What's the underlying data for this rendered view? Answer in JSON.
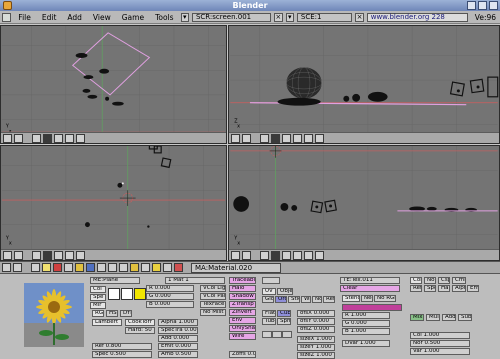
{
  "window": {
    "title": "Blender"
  },
  "menubar": {
    "items": [
      "File",
      "Edit",
      "Add",
      "View",
      "Game",
      "Tools"
    ],
    "screen_field": "SCR:screen.001",
    "scene_field": "SCE:1",
    "url": "www.blender.org 228",
    "ve_label": "Ve:96"
  },
  "viewports": [
    {
      "axis_label": "Y",
      "axis_sub": "Z"
    },
    {
      "axis_label": "Y",
      "axis_sub": "X"
    },
    {
      "axis_label": "Y",
      "axis_sub": "X"
    },
    {
      "axis_label": "Y",
      "axis_sub": "X"
    }
  ],
  "buttonbar": {
    "material_field": "MA:Material.020"
  },
  "material": {
    "me_field": "ME:Plane",
    "mat_count": "1 Mat 1",
    "rgb": [
      "R 0.000",
      "G 0.000",
      "B 0.000"
    ],
    "color_labels": [
      "RGB",
      "HSV",
      "DYN",
      "Col",
      "Spe",
      "Mir"
    ],
    "buttons": {
      "halo": "Halo",
      "traceable": "Traceable",
      "shadow": "Shadow",
      "ztransp": "ZTransp",
      "zinvert": "Zinvert",
      "env": "Env",
      "onlyshadow": "OnlyShadow",
      "wire": "Wire"
    },
    "sliders": {
      "alpha": "Alpha 1.000",
      "spec_tra": "SpecTra 0.00",
      "add": "Add 0.000",
      "emit": "Emit 0.000",
      "amb": "Amb 0.500",
      "ref": "Ref 0.800",
      "spec": "Spec 0.500",
      "hard": "Hard: 50",
      "zoffs": "Zoffs 0.000"
    },
    "shader": {
      "lambert": "Lambert",
      "cooktorr": "CookTorr",
      "vcol_light": "VCol Light",
      "vcol_paint": "VCol Paint",
      "texface": "TexFace",
      "nomist": "No Mist"
    }
  },
  "texture": {
    "tex_field": "TE:Tex.011",
    "clear_label": "Clear",
    "map_buttons": [
      "UV",
      "Object",
      "Glob",
      "Orco",
      "Stick",
      "Win",
      "Nor",
      "Refl"
    ],
    "flat_buttons": [
      "Flat",
      "Cube",
      "Tube",
      "Sphe"
    ],
    "offsets": [
      "ofsX 0.000",
      "ofsY 0.000",
      "ofsZ 0.000"
    ],
    "sizes": [
      "sizeX 1.000",
      "sizeY 1.000",
      "sizeZ 1.000"
    ],
    "mix_buttons": [
      "Col",
      "Nor",
      "Csp",
      "Cmir",
      "Ref",
      "Spec",
      "Hard",
      "Alpha",
      "Emit"
    ],
    "blend_buttons": [
      "Mix",
      "Mul",
      "Add",
      "Sub"
    ],
    "stencil": [
      "Stencil",
      "Neg",
      "No RGB"
    ],
    "values": [
      "R 1.000",
      "G 0.000",
      "B 1.000",
      "DVar 1.000",
      "Col 1.000",
      "Nor 0.500",
      "Var 1.000"
    ]
  },
  "colors": {
    "viewport_bg": "#747474",
    "grid": "#686868",
    "axis_x": "#c06060",
    "axis_y": "#60a060",
    "selection": "#e0a0e0",
    "header": "#a9a9a9"
  }
}
